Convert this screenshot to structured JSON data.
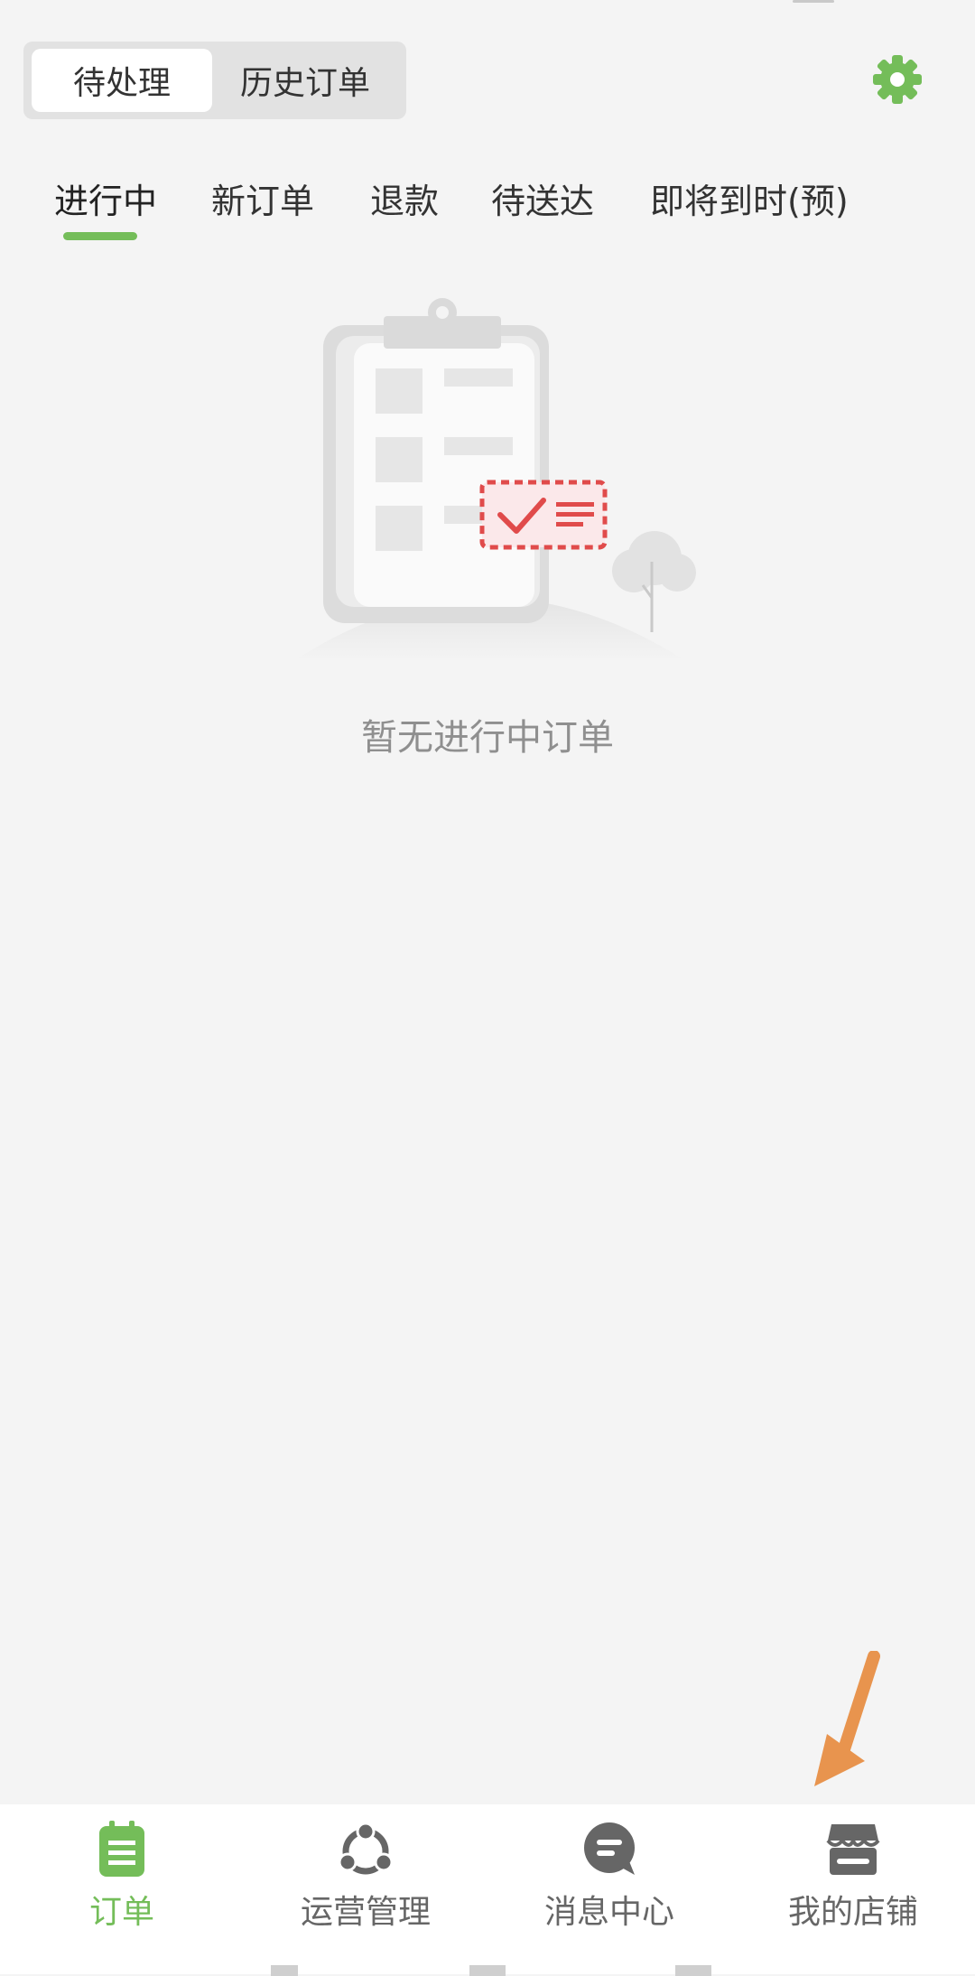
{
  "segmented": {
    "active": "待处理",
    "inactive": "历史订单"
  },
  "header": {
    "settings_icon": "gear-icon",
    "accent_color": "#74bd59"
  },
  "tabs": [
    {
      "label": "进行中",
      "active": true
    },
    {
      "label": "新订单",
      "active": false
    },
    {
      "label": "退款",
      "active": false
    },
    {
      "label": "待送达",
      "active": false
    },
    {
      "label": "即将到时(预)",
      "active": false
    }
  ],
  "empty_state": {
    "icon": "clipboard-illustration",
    "message": "暂无进行中订单"
  },
  "bottom_nav": [
    {
      "label": "订单",
      "icon": "order-icon",
      "active": true
    },
    {
      "label": "运营管理",
      "icon": "operations-icon",
      "active": false
    },
    {
      "label": "消息中心",
      "icon": "message-icon",
      "active": false
    },
    {
      "label": "我的店铺",
      "icon": "store-icon",
      "active": false
    }
  ],
  "annotation": {
    "color": "#e8944e"
  }
}
